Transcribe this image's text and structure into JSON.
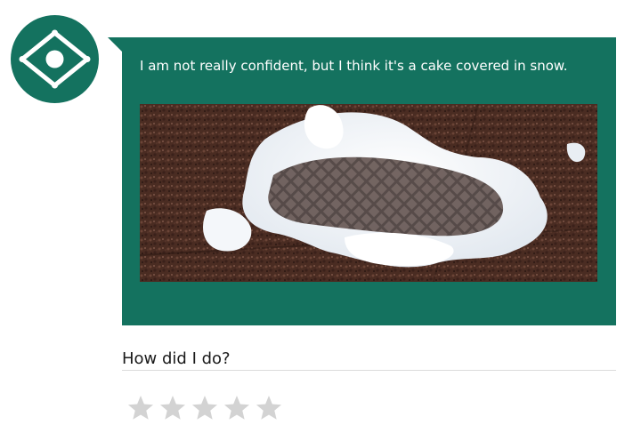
{
  "bot": {
    "avatar_icon": "eye-diamond-icon",
    "brand_color": "#14725f"
  },
  "message": {
    "text": "I am not really confident, but I think it's a cake covered in snow.",
    "image_description_icon": "snow-footprint-photo"
  },
  "feedback": {
    "prompt": "How did I do?",
    "rating": {
      "max": 5,
      "value": 0,
      "star_icon": "star-icon",
      "star_color_empty": "#d3d3d3"
    }
  }
}
